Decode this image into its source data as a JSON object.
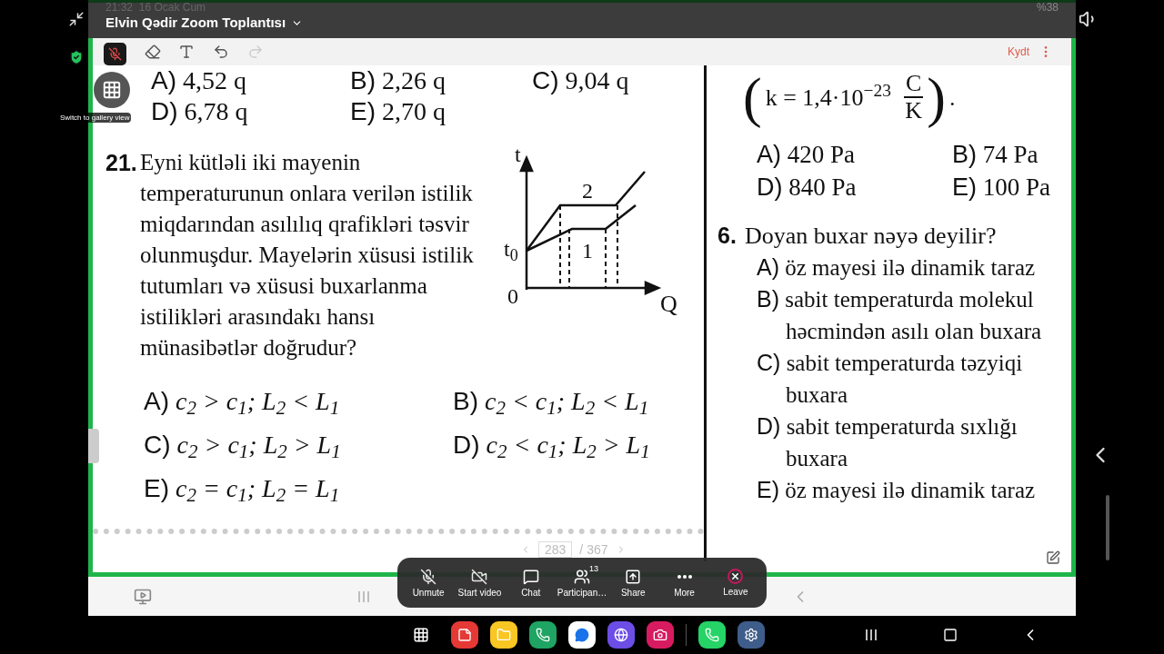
{
  "status_bar": {
    "time": "21:32",
    "date": "16 Ocak Cum",
    "battery": "%38"
  },
  "meeting": {
    "title": "Elvin Qədir Zoom Toplantısı",
    "mic_muted": true
  },
  "gallery_hint": "Switch to gallery view",
  "annotation_toolbar": {
    "save": "Kydt"
  },
  "document": {
    "left": {
      "prev_options": [
        {
          "letter": "A)",
          "text": "4,52 q"
        },
        {
          "letter": "B)",
          "text": "2,26 q"
        },
        {
          "letter": "C)",
          "text": "9,04 q"
        },
        {
          "letter": "D)",
          "text": "6,78 q"
        },
        {
          "letter": "E)",
          "text": "2,70 q"
        }
      ],
      "question": {
        "number": "21.",
        "text": "Eyni kütləli iki mayenin temperaturunun onlara verilən istilik miqdarından asılılıq qrafikləri təsvir olunmuşdur. Mayelərin xüsusi istilik tutumları və xüsusi buxarlanma istilikləri arasındakı hansı münasibətlər doğrudur?",
        "graph_labels": {
          "y_axis": "t",
          "t0": "t$_{0}$",
          "origin": "0",
          "x_axis": "Q",
          "upper": "2",
          "lower": "1"
        },
        "options": [
          {
            "letter": "A)",
            "text": "c$_{2}$ > c$_{1}$; L$_{2}$ < L$_{1}$"
          },
          {
            "letter": "B)",
            "text": "c$_{2}$ < c$_{1}$; L$_{2}$ < L$_{1}$"
          },
          {
            "letter": "C)",
            "text": "c$_{2}$ > c$_{1}$; L$_{2}$ > L$_{1}$"
          },
          {
            "letter": "D)",
            "text": "c$_{2}$ < c$_{1}$; L$_{2}$ > L$_{1}$"
          },
          {
            "letter": "E)",
            "text": "c$_{2}$ = c$_{1}$; L$_{2}$ = L$_{1}$"
          }
        ]
      }
    },
    "right": {
      "formula": {
        "open": "(",
        "lhs": "k = 1,4·10$^{−23}$",
        "numerator": "C",
        "denominator": "K",
        "close": ")",
        "end": "."
      },
      "prev_options": [
        {
          "letter": "A)",
          "text": "420 Pa"
        },
        {
          "letter": "B)",
          "text": "74 Pa"
        },
        {
          "letter": "D)",
          "text": "840 Pa"
        },
        {
          "letter": "E)",
          "text": "100 Pa"
        }
      ],
      "question": {
        "number": "6.",
        "text": "Doyan buxar nəyə deyilir?",
        "options": [
          {
            "letter": "A)",
            "lines": [
              "öz mayesi ilə dinamik taraz"
            ]
          },
          {
            "letter": "B)",
            "lines": [
              "sabit temperaturda molekul",
              "həcmindən asılı olan buxara"
            ]
          },
          {
            "letter": "C)",
            "lines": [
              "sabit temperaturda təzyiqi",
              "buxara"
            ]
          },
          {
            "letter": "D)",
            "lines": [
              "sabit temperaturda sıxlığı",
              "buxara"
            ]
          },
          {
            "letter": "E)",
            "lines": [
              "öz mayesi ilə dinamik taraz"
            ]
          }
        ]
      }
    }
  },
  "page_indicator": {
    "current": "283",
    "total": "/ 367"
  },
  "toolbar": [
    {
      "kind": "mic",
      "label": "Unmute",
      "off": true
    },
    {
      "kind": "video",
      "label": "Start video",
      "off": true
    },
    {
      "kind": "chat",
      "label": "Chat",
      "off": false
    },
    {
      "kind": "participants",
      "label": "Participan…",
      "badge": "13",
      "off": false
    },
    {
      "kind": "share",
      "label": "Share",
      "off": false
    },
    {
      "kind": "more",
      "label": "More",
      "off": false
    },
    {
      "kind": "leave",
      "label": "Leave",
      "off": false
    }
  ],
  "dock": [
    {
      "kind": "notes",
      "color": "#e53935"
    },
    {
      "kind": "files",
      "color": "#f9c623"
    },
    {
      "kind": "phone",
      "color": "#1fa463"
    },
    {
      "kind": "messages",
      "color": "#ffffff"
    },
    {
      "kind": "browser",
      "color": "#6c4de6"
    },
    {
      "kind": "camera",
      "color": "#d81b60"
    },
    {
      "kind": "whatsapp",
      "color": "#25d366"
    },
    {
      "kind": "settings",
      "color": "#3f5d8a"
    }
  ]
}
